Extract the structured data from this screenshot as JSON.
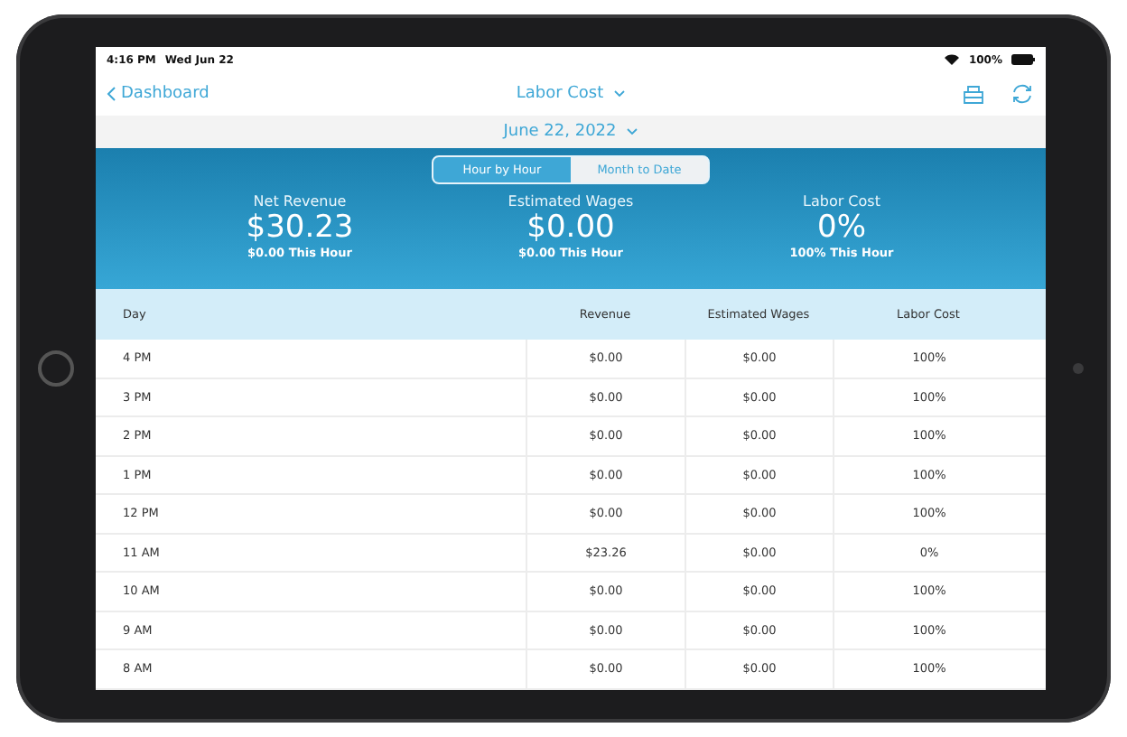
{
  "status_bar": {
    "time": "4:16 PM",
    "date": "Wed Jun 22",
    "battery": "100%"
  },
  "nav": {
    "back": "Dashboard",
    "title": "Labor Cost"
  },
  "date_picker": {
    "value": "June 22, 2022"
  },
  "tabs": [
    {
      "label": "Hour by Hour",
      "selected": true
    },
    {
      "label": "Month to Date",
      "selected": false
    }
  ],
  "summary": [
    {
      "label": "Net Revenue",
      "value": "$30.23",
      "sub": "$0.00 This Hour"
    },
    {
      "label": "Estimated Wages",
      "value": "$0.00",
      "sub": "$0.00 This Hour"
    },
    {
      "label": "Labor Cost",
      "value": "0%",
      "sub": "100% This Hour"
    }
  ],
  "table": {
    "columns": [
      "Day",
      "Revenue",
      "Estimated Wages",
      "Labor Cost"
    ],
    "rows": [
      [
        "4 PM",
        "$0.00",
        "$0.00",
        "100%"
      ],
      [
        "3 PM",
        "$0.00",
        "$0.00",
        "100%"
      ],
      [
        "2 PM",
        "$0.00",
        "$0.00",
        "100%"
      ],
      [
        "1 PM",
        "$0.00",
        "$0.00",
        "100%"
      ],
      [
        "12 PM",
        "$0.00",
        "$0.00",
        "100%"
      ],
      [
        "11 AM",
        "$23.26",
        "$0.00",
        "0%"
      ],
      [
        "10 AM",
        "$0.00",
        "$0.00",
        "100%"
      ],
      [
        "9 AM",
        "$0.00",
        "$0.00",
        "100%"
      ],
      [
        "8 AM",
        "$0.00",
        "$0.00",
        "100%"
      ]
    ]
  }
}
